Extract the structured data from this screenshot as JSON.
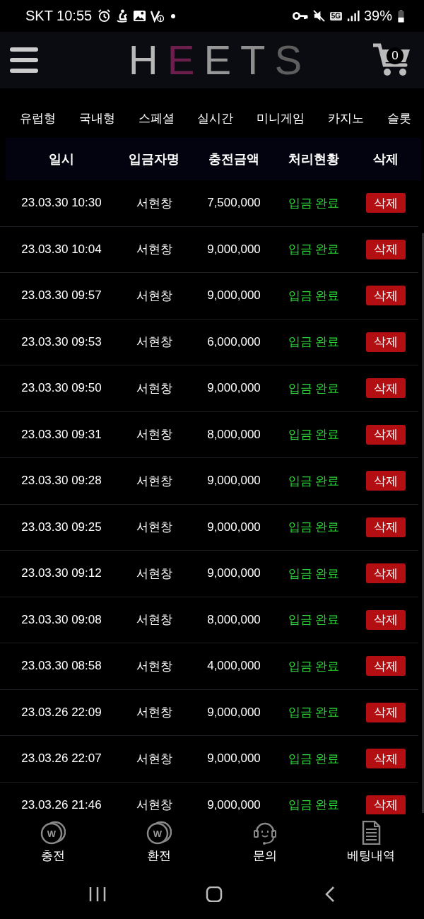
{
  "status_bar": {
    "carrier_time": "SKT 10:55",
    "network": "5G",
    "battery": "39%"
  },
  "header": {
    "logo": "HEETS",
    "cart_count": "0"
  },
  "tabs": [
    {
      "label": "유럽형"
    },
    {
      "label": "국내형"
    },
    {
      "label": "스페셜"
    },
    {
      "label": "실시간"
    },
    {
      "label": "미니게임"
    },
    {
      "label": "카지노"
    },
    {
      "label": "슬롯"
    }
  ],
  "table": {
    "columns": [
      "일시",
      "입금자명",
      "충전금액",
      "처리현황",
      "삭제"
    ],
    "rows": [
      {
        "date": "23.03.30 10:30",
        "name": "서현창",
        "amount": "7,500,000",
        "status": "입금 완료",
        "action": "삭제"
      },
      {
        "date": "23.03.30 10:04",
        "name": "서현창",
        "amount": "9,000,000",
        "status": "입금 완료",
        "action": "삭제"
      },
      {
        "date": "23.03.30 09:57",
        "name": "서현창",
        "amount": "9,000,000",
        "status": "입금 완료",
        "action": "삭제"
      },
      {
        "date": "23.03.30 09:53",
        "name": "서현창",
        "amount": "6,000,000",
        "status": "입금 완료",
        "action": "삭제"
      },
      {
        "date": "23.03.30 09:50",
        "name": "서현창",
        "amount": "9,000,000",
        "status": "입금 완료",
        "action": "삭제"
      },
      {
        "date": "23.03.30 09:31",
        "name": "서현창",
        "amount": "8,000,000",
        "status": "입금 완료",
        "action": "삭제"
      },
      {
        "date": "23.03.30 09:28",
        "name": "서현창",
        "amount": "9,000,000",
        "status": "입금 완료",
        "action": "삭제"
      },
      {
        "date": "23.03.30 09:25",
        "name": "서현창",
        "amount": "9,000,000",
        "status": "입금 완료",
        "action": "삭제"
      },
      {
        "date": "23.03.30 09:12",
        "name": "서현창",
        "amount": "9,000,000",
        "status": "입금 완료",
        "action": "삭제"
      },
      {
        "date": "23.03.30 09:08",
        "name": "서현창",
        "amount": "8,000,000",
        "status": "입금 완료",
        "action": "삭제"
      },
      {
        "date": "23.03.30 08:58",
        "name": "서현창",
        "amount": "4,000,000",
        "status": "입금 완료",
        "action": "삭제"
      },
      {
        "date": "23.03.26 22:09",
        "name": "서현창",
        "amount": "9,000,000",
        "status": "입금 완료",
        "action": "삭제"
      },
      {
        "date": "23.03.26 22:07",
        "name": "서현창",
        "amount": "9,000,000",
        "status": "입금 완료",
        "action": "삭제"
      },
      {
        "date": "23.03.26 21:46",
        "name": "서현창",
        "amount": "9,000,000",
        "status": "입금 완료",
        "action": "삭제"
      }
    ]
  },
  "bottom_nav": [
    {
      "kind": "coin",
      "icon_text": "W",
      "label": "충전"
    },
    {
      "kind": "coin",
      "icon_text": "W",
      "label": "환전"
    },
    {
      "kind": "headset",
      "label": "문의"
    },
    {
      "kind": "document",
      "label": "베팅내역"
    }
  ]
}
